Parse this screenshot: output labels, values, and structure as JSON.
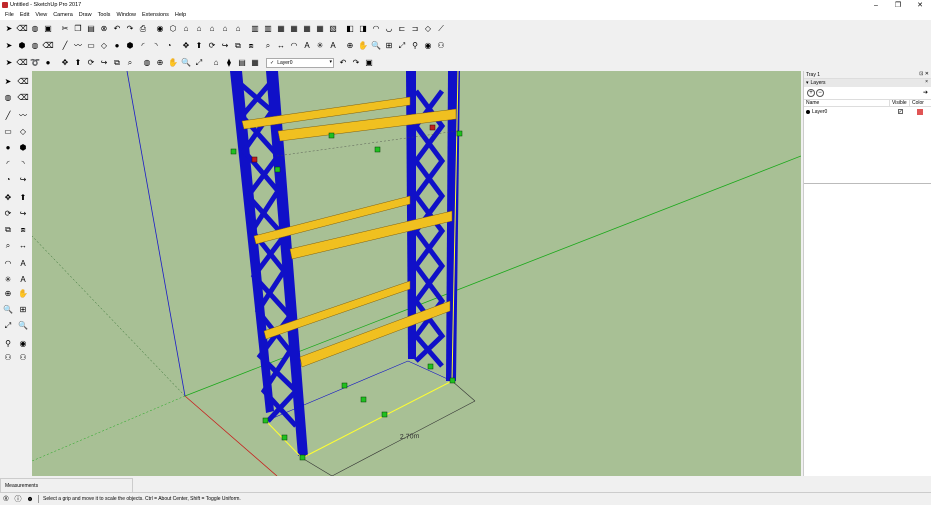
{
  "window": {
    "title": "Untitled - SketchUp Pro 2017",
    "controls": {
      "minimize": "–",
      "maximize": "❐",
      "close": "✕"
    }
  },
  "menu": [
    "File",
    "Edit",
    "View",
    "Camera",
    "Draw",
    "Tools",
    "Window",
    "Extensions",
    "Help"
  ],
  "toolbar": {
    "row1_icons": [
      "select-icon",
      "eraser-icon",
      "paint-bucket-icon",
      "save-icon",
      "cut-icon",
      "copy-icon",
      "paste-icon",
      "erase-icon",
      "undo-icon",
      "redo-icon",
      "print-icon",
      "model-info-icon",
      "iso-view-icon",
      "top-view-icon",
      "front-view-icon",
      "right-view-icon",
      "back-view-icon",
      "left-view-icon",
      "xray-icon",
      "back-edges-icon",
      "wireframe-icon",
      "hidden-line-icon",
      "shaded-icon",
      "shaded-textures-icon",
      "monochrome-icon",
      "section-plane-icon",
      "section-cuts-icon",
      "sandbox-icon",
      "smoove-icon",
      "stamp-icon",
      "drape-icon",
      "add-detail-icon",
      "flip-edge-icon"
    ],
    "row2_icons": [
      "select-icon",
      "make-component-icon",
      "paint-bucket-icon",
      "eraser-icon",
      "line-icon",
      "freehand-icon",
      "rectangle-icon",
      "rotated-rect-icon",
      "circle-icon",
      "polygon-icon",
      "arc-icon",
      "two-point-arc-icon",
      "pie-icon",
      "move-icon",
      "push-pull-icon",
      "rotate-icon",
      "follow-me-icon",
      "scale-icon",
      "offset-icon",
      "tape-measure-icon",
      "dimension-icon",
      "protractor-icon",
      "text-icon",
      "axes-icon",
      "3d-text-icon",
      "orbit-icon",
      "pan-icon",
      "zoom-icon",
      "zoom-window-icon",
      "zoom-extents-icon",
      "position-camera-icon",
      "look-around-icon",
      "walk-icon"
    ],
    "row3_icons": [
      "select-icon",
      "eraser-icon",
      "lasso-icon",
      "circle-tool-icon",
      "move-icon",
      "push-pull-icon",
      "rotate-icon",
      "follow-me-icon",
      "scale-icon",
      "tape-measure-icon",
      "paint-icon",
      "orbit-icon",
      "pan-icon",
      "zoom-icon",
      "zoom-extents-icon",
      "warehouse-icon",
      "extension-warehouse-icon",
      "layout-icon",
      "layer-icon"
    ],
    "layer_select": "Layer0",
    "layer_check": "✓",
    "row3_after_icons": [
      "previous-view-icon",
      "next-view-icon",
      "standard-views-icon"
    ]
  },
  "tray": {
    "title": "Tray 1",
    "panel_title": "Layers",
    "columns": {
      "name": "Name",
      "visible": "Visible",
      "color": "Color"
    },
    "layers": [
      {
        "name": "Layer0",
        "visible": true,
        "color": "#e05555"
      }
    ]
  },
  "viewport": {
    "dimension_label": "2.70m",
    "colors": {
      "background": "#a8c095",
      "frame": "#1010c8",
      "beam": "#f0c020"
    }
  },
  "measurements_label": "Measurements",
  "status": {
    "message": "Select a grip and move it to scale the objects. Ctrl = About Center, Shift = Toggle Uniform."
  }
}
